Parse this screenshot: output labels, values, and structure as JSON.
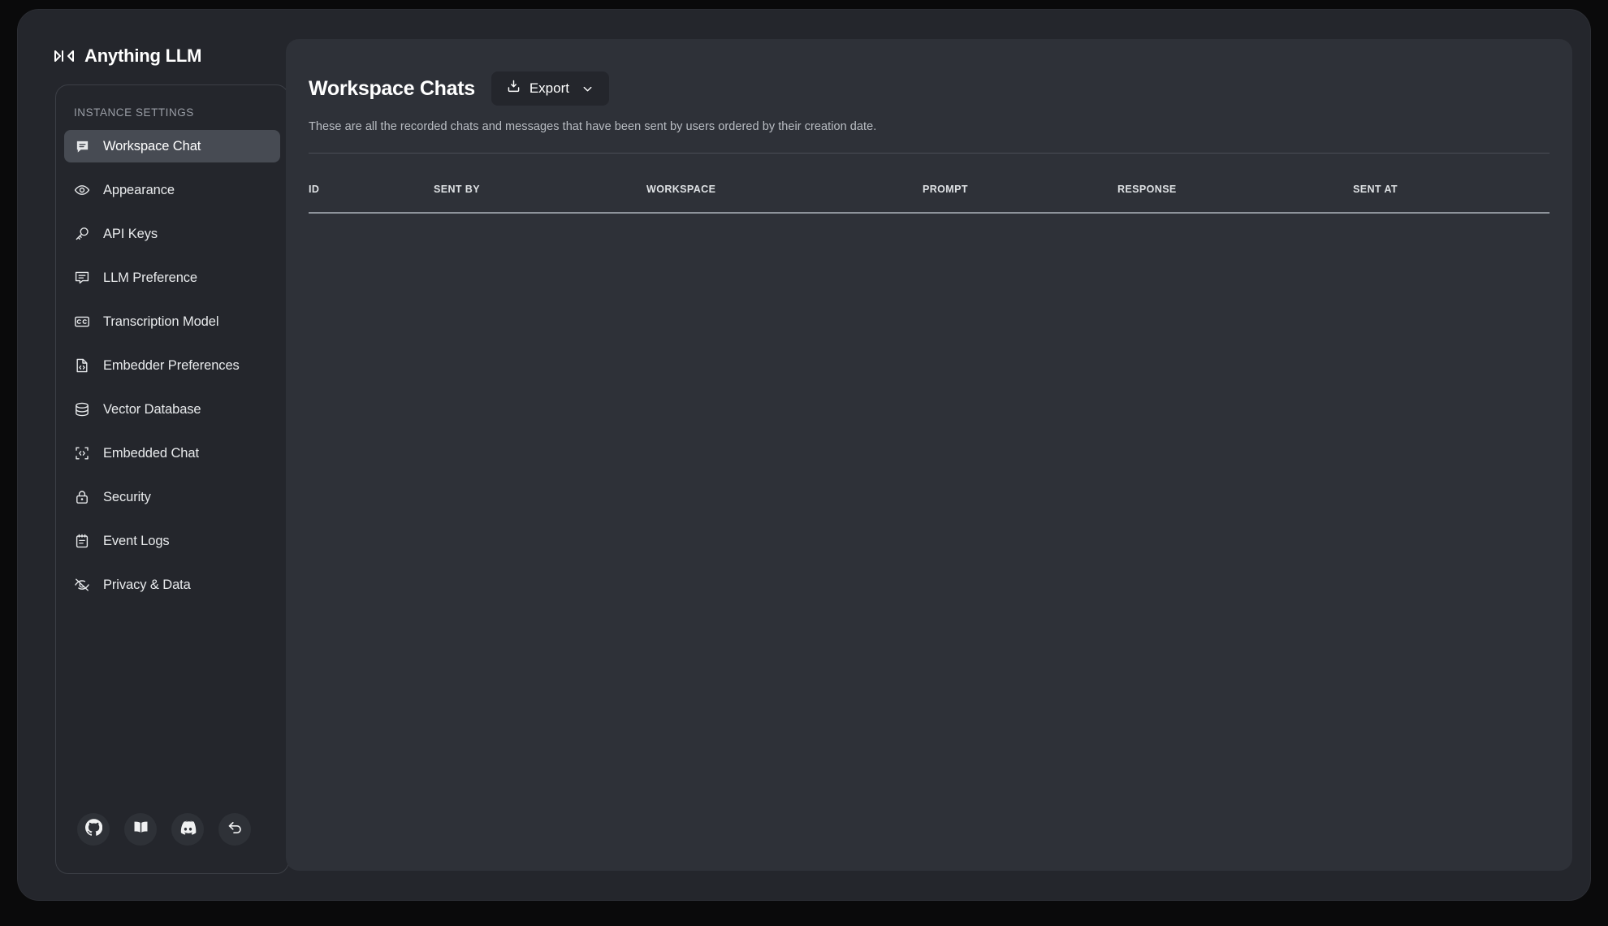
{
  "brand": {
    "name": "Anything LLM",
    "logo_icon": "anythingllm-logo-icon"
  },
  "sidebar": {
    "section_label": "INSTANCE SETTINGS",
    "items": [
      {
        "label": "Workspace Chat",
        "icon": "chat-bubble-icon",
        "active": true
      },
      {
        "label": "Appearance",
        "icon": "eye-icon",
        "active": false
      },
      {
        "label": "API Keys",
        "icon": "key-icon",
        "active": false
      },
      {
        "label": "LLM Preference",
        "icon": "chat-centered-icon",
        "active": false
      },
      {
        "label": "Transcription Model",
        "icon": "closed-caption-icon",
        "active": false
      },
      {
        "label": "Embedder Preferences",
        "icon": "file-code-icon",
        "active": false
      },
      {
        "label": "Vector Database",
        "icon": "database-icon",
        "active": false
      },
      {
        "label": "Embedded Chat",
        "icon": "code-window-icon",
        "active": false
      },
      {
        "label": "Security",
        "icon": "lock-icon",
        "active": false
      },
      {
        "label": "Event Logs",
        "icon": "notebook-icon",
        "active": false
      },
      {
        "label": "Privacy & Data",
        "icon": "eye-slash-icon",
        "active": false
      }
    ],
    "footer_buttons": [
      {
        "name": "github-link",
        "icon": "github-icon"
      },
      {
        "name": "docs-link",
        "icon": "book-open-icon"
      },
      {
        "name": "discord-link",
        "icon": "discord-icon"
      },
      {
        "name": "back-link",
        "icon": "arrow-u-turn-left-icon"
      }
    ]
  },
  "main": {
    "title": "Workspace Chats",
    "export_label": "Export",
    "export_icon": "download-tray-icon",
    "export_caret_icon": "chevron-down-icon",
    "subtitle": "These are all the recorded chats and messages that have been sent by users ordered by their creation date.",
    "table": {
      "columns": [
        "ID",
        "SENT BY",
        "WORKSPACE",
        "PROMPT",
        "RESPONSE",
        "SENT AT"
      ],
      "rows": []
    }
  },
  "colors": {
    "window_bg": "#24262c",
    "panel_bg": "#2e3138",
    "active_nav_bg": "#474b53",
    "text_primary": "#ffffff",
    "text_muted": "#b9bdc3",
    "divider": "#4a4e56"
  }
}
